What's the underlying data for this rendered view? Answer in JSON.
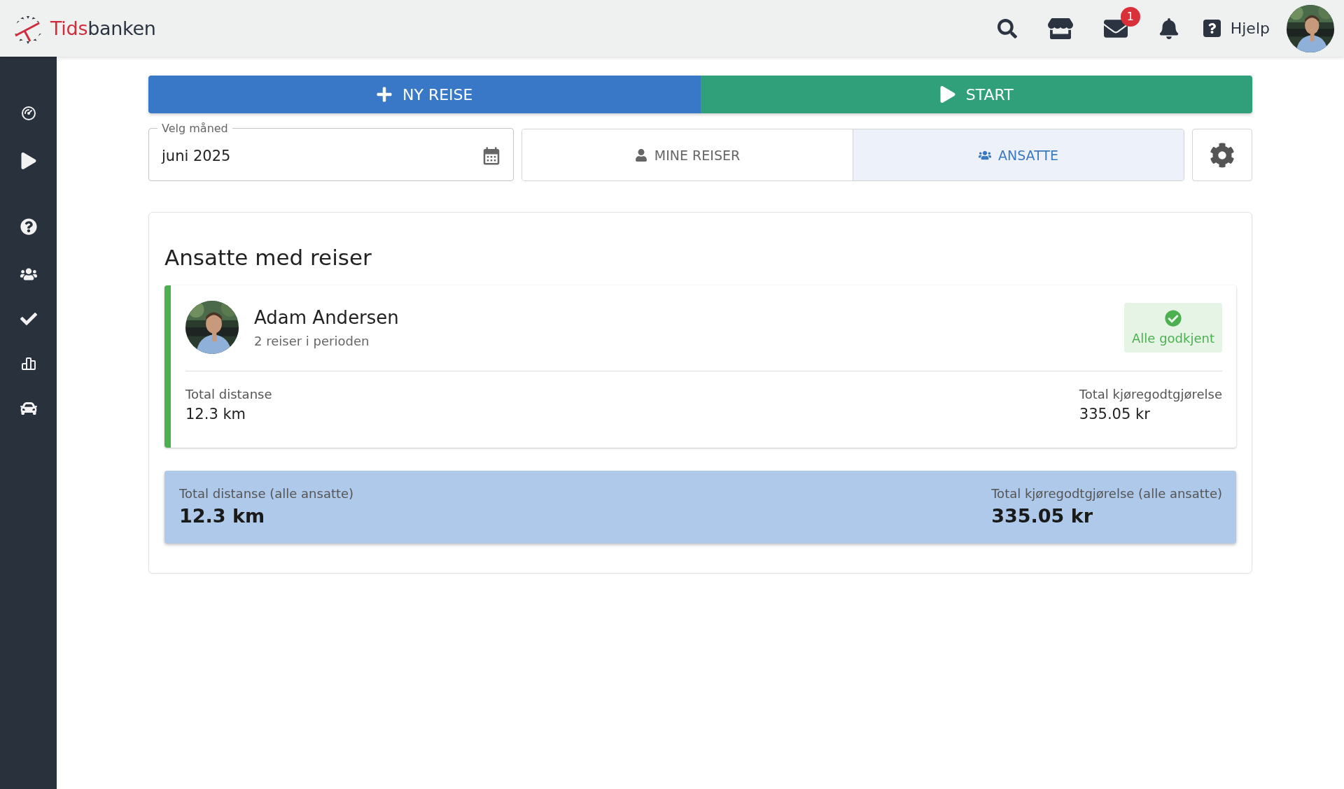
{
  "header": {
    "logo": {
      "part_1": "Tids",
      "part_2": "banken"
    },
    "mail_badge": "1",
    "help": "Hjelp"
  },
  "actions": [
    {
      "kind": "new",
      "label": "NY REISE"
    },
    {
      "kind": "start",
      "label": "START"
    }
  ],
  "month_field": {
    "label": "Velg måned",
    "value": "juni 2025"
  },
  "tabs": [
    {
      "label": "MINE REISER",
      "selected": false
    },
    {
      "label": "ANSATTE",
      "selected": true
    }
  ],
  "panel": {
    "title": "Ansatte med reiser",
    "employees": [
      {
        "name": "Adam Andersen",
        "subtitle": "2 reiser i perioden",
        "status": {
          "kind": "approved",
          "label": "Alle godkjent"
        },
        "distance_label": "Total distanse",
        "distance": "12.3 km",
        "allowance_label": "Total kjøregodtgjørelse",
        "allowance": "335.05 kr"
      }
    ],
    "totals": {
      "distance_label": "Total distanse (alle ansatte)",
      "distance": "12.3 km",
      "allowance_label": "Total kjøregodtgjørelse (alle ansatte)",
      "allowance": "335.05 kr"
    }
  }
}
